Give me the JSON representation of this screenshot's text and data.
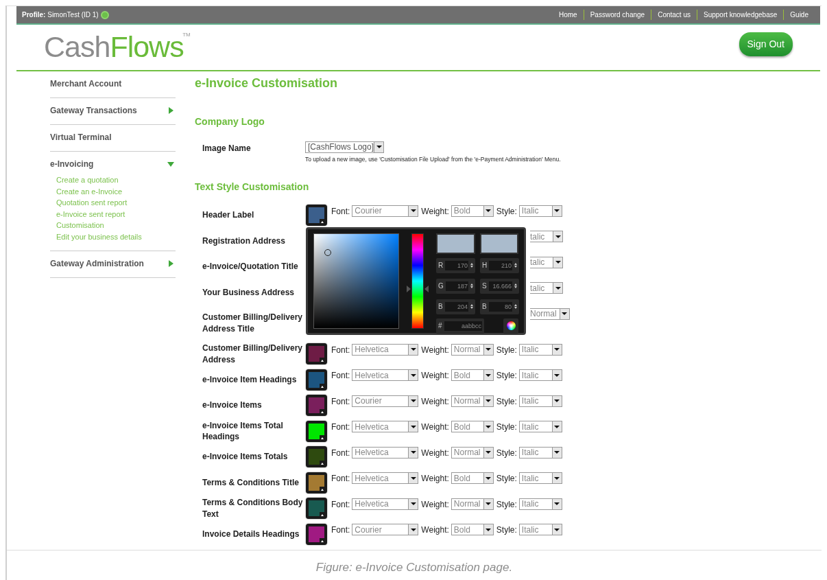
{
  "topbar": {
    "profile_label": "Profile:",
    "profile_value": "SimonTest (ID 1)",
    "links": [
      "Home",
      "Password change",
      "Contact us",
      "Support knowledgebase",
      "Guide"
    ]
  },
  "logo": {
    "part_1": "Cash",
    "part_2": "Flows",
    "mark": "TM"
  },
  "sign_out": "Sign Out",
  "sidebar": {
    "items": [
      {
        "label": "Merchant Account"
      },
      {
        "label": "Gateway Transactions",
        "expanded": false
      },
      {
        "label": "Virtual Terminal"
      },
      {
        "label": "e-Invoicing",
        "expanded": true,
        "children": [
          {
            "label": "Create a quotation"
          },
          {
            "label": "Create an e-Invoice"
          },
          {
            "label": "Quotation sent report"
          },
          {
            "label": "e-Invoice sent report"
          },
          {
            "label": "Customisation"
          },
          {
            "label": "Edit your business details"
          }
        ]
      },
      {
        "label": "Gateway Administration",
        "expanded": false
      }
    ]
  },
  "page_title": "e-Invoice Customisation",
  "company_logo": {
    "heading": "Company Logo",
    "label": "Image Name",
    "value": "[CashFlows Logo]",
    "hint": "To upload a new image, use 'Customisation File Upload' from the 'e-Payment Administration' Menu."
  },
  "text_style": {
    "heading": "Text Style Customisation",
    "rows": [
      {
        "kind": "full",
        "label": "Header Label",
        "color": "#3b5f8c",
        "font_label": "Font:",
        "font": "Courier",
        "weight_label": "Weight:",
        "weight": "Bold",
        "style_label": "Style:",
        "style": "Italic"
      },
      {
        "kind": "covered",
        "label": "Registration Address",
        "style": "talic"
      },
      {
        "kind": "covered",
        "label": "e-Invoice/Quotation Title",
        "style": "talic"
      },
      {
        "kind": "covered",
        "label": "Your Business Address",
        "style": "talic"
      },
      {
        "kind": "covered",
        "label": "Customer Billing/Delivery Address Title",
        "style": "Normal"
      },
      {
        "kind": "full",
        "label": "Customer Billing/Delivery Address",
        "color": "#6e1c45",
        "font_label": "Font:",
        "font": "Helvetica",
        "weight_label": "Weight:",
        "weight": "Normal",
        "style_label": "Style:",
        "style": "Italic"
      },
      {
        "kind": "full",
        "label": "e-Invoice Item Headings",
        "color": "#1c5580",
        "font_label": "Font:",
        "font": "Helvetica",
        "weight_label": "Weight:",
        "weight": "Bold",
        "style_label": "Style:",
        "style": "Italic"
      },
      {
        "kind": "full",
        "label": "e-Invoice Items",
        "color": "#7a1f5c",
        "font_label": "Font:",
        "font": "Courier",
        "weight_label": "Weight:",
        "weight": "Normal",
        "style_label": "Style:",
        "style": "Italic"
      },
      {
        "kind": "full",
        "label": "e-Invoice Items Total Headings",
        "color": "#00e600",
        "font_label": "Font:",
        "font": "Helvetica",
        "weight_label": "Weight:",
        "weight": "Bold",
        "style_label": "Style:",
        "style": "Italic"
      },
      {
        "kind": "full",
        "label": "e-Invoice Items Totals",
        "color": "#2e4a0f",
        "font_label": "Font:",
        "font": "Helvetica",
        "weight_label": "Weight:",
        "weight": "Normal",
        "style_label": "Style:",
        "style": "Italic"
      },
      {
        "kind": "full",
        "label": "Terms & Conditions Title",
        "color": "#a47a32",
        "font_label": "Font:",
        "font": "Helvetica",
        "weight_label": "Weight:",
        "weight": "Bold",
        "style_label": "Style:",
        "style": "Italic"
      },
      {
        "kind": "full",
        "label": "Terms & Conditions Body Text",
        "color": "#185a50",
        "font_label": "Font:",
        "font": "Helvetica",
        "weight_label": "Weight:",
        "weight": "Normal",
        "style_label": "Style:",
        "style": "Italic"
      },
      {
        "kind": "full",
        "label": "Invoice Details Headings",
        "color": "#a01a82",
        "font_label": "Font:",
        "font": "Courier",
        "weight_label": "Weight:",
        "weight": "Bold",
        "style_label": "Style:",
        "style": "Italic"
      }
    ]
  },
  "color_picker": {
    "hue_slider": {
      "level": 0.42
    },
    "fields": [
      {
        "label": "R",
        "value": "170"
      },
      {
        "label": "H",
        "value": "210"
      },
      {
        "label": "G",
        "value": "187"
      },
      {
        "label": "S",
        "value": "16.666"
      },
      {
        "label": "B",
        "value": "204"
      },
      {
        "label": "B",
        "value": "80"
      }
    ],
    "hex_label": "#",
    "hex": "aabbcc"
  },
  "caption": "Figure: e-Invoice Customisation page."
}
